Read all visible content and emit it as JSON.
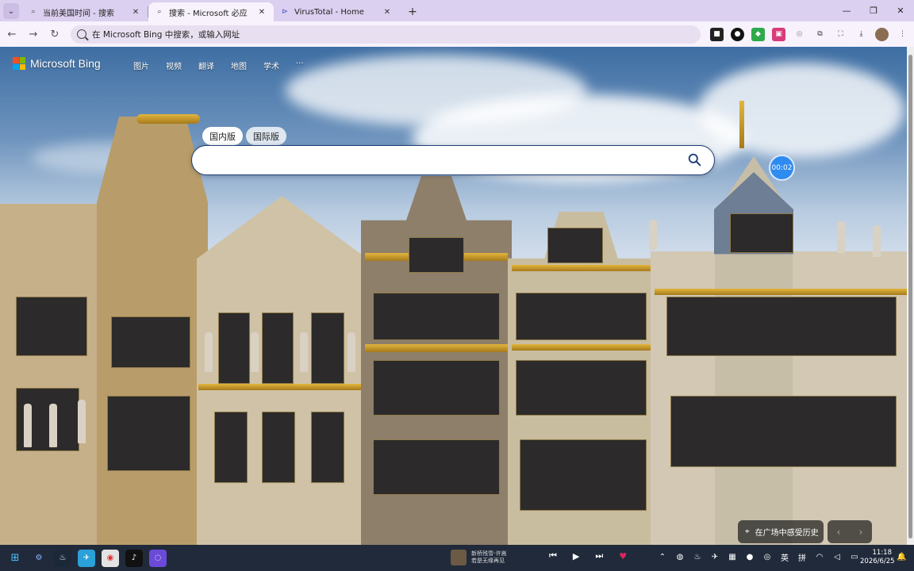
{
  "browser": {
    "tabs": [
      {
        "title": "当前美国时间 - 搜索",
        "icon": "search-icon",
        "active": false
      },
      {
        "title": "搜索 - Microsoft 必应",
        "icon": "search-icon",
        "active": true
      },
      {
        "title": "VirusTotal - Home",
        "icon": "virustotal-icon",
        "active": false
      }
    ],
    "address_placeholder": "在 Microsoft Bing 中搜索，或输入网址"
  },
  "bing": {
    "logo_text": "Microsoft Bing",
    "nav": [
      "图片",
      "视频",
      "翻译",
      "地图",
      "学术",
      "···"
    ],
    "scope_tabs": [
      "国内版",
      "国际版"
    ],
    "timer": "00:02",
    "image_caption": "在广场中感受历史",
    "colors": {
      "accent": "#1f3f7a",
      "timer": "#2e8bf0"
    }
  },
  "taskbar": {
    "media": {
      "line1": "新桥残雪-许嵩",
      "line2": "若是无缘再见"
    },
    "tray_ime": [
      "英",
      "拼"
    ],
    "time": "11:18",
    "date": "2026/6/25"
  }
}
